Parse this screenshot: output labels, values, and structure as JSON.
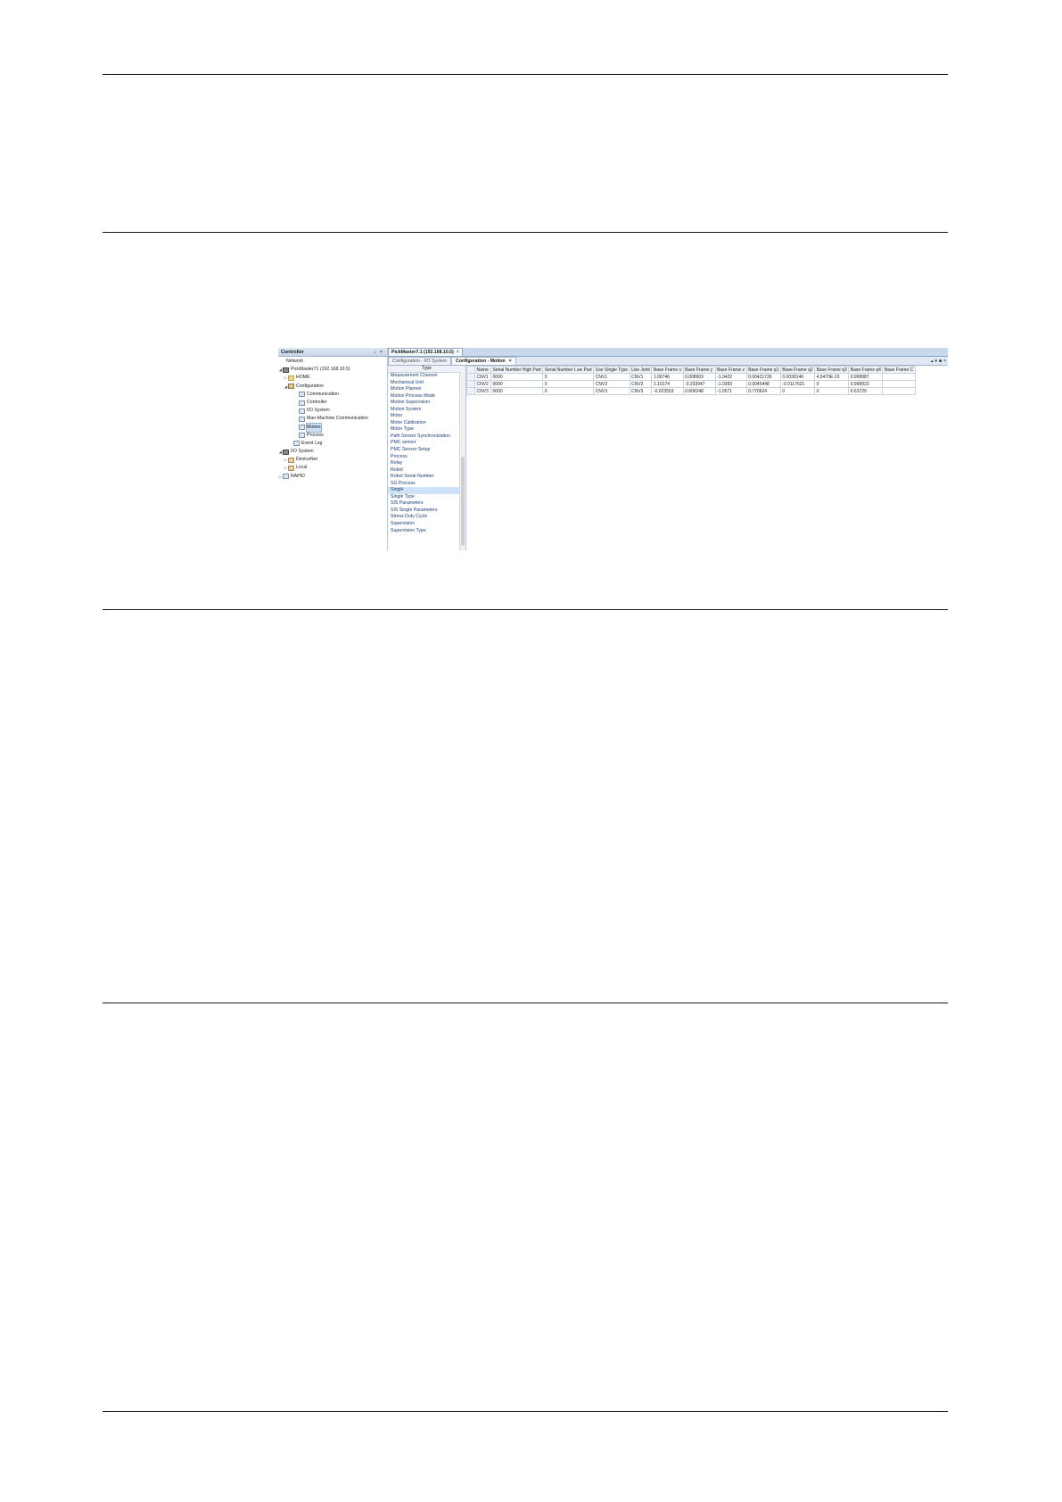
{
  "controller_pane": {
    "title": "Controller",
    "pin_glyph": "↓",
    "close_glyph": "×",
    "tree": [
      {
        "label": "Network",
        "icon": "none",
        "toggle": ""
      },
      {
        "label": "PickMaster71 (192.168.10.5)",
        "icon": "controller-icon",
        "toggle": "◢"
      },
      {
        "label": "HOME",
        "icon": "folder-icon",
        "toggle": "▷"
      },
      {
        "label": "Configuration",
        "icon": "configuration-icon",
        "toggle": "◢"
      },
      {
        "label": "Communication",
        "icon": "topic-icon",
        "toggle": ""
      },
      {
        "label": "Controller",
        "icon": "topic-icon",
        "toggle": ""
      },
      {
        "label": "I/O System",
        "icon": "topic-icon",
        "toggle": ""
      },
      {
        "label": "Man-Machine Communication",
        "icon": "topic-icon",
        "toggle": ""
      },
      {
        "label": "Motion",
        "icon": "topic-icon",
        "toggle": "",
        "selected": true
      },
      {
        "label": "Process",
        "icon": "topic-icon",
        "toggle": ""
      },
      {
        "label": "Event Log",
        "icon": "event-log-icon",
        "toggle": ""
      },
      {
        "label": "I/O System",
        "icon": "io-system-icon",
        "toggle": "◢"
      },
      {
        "label": "DeviceNet",
        "icon": "network-icon",
        "toggle": "▷"
      },
      {
        "label": "Local",
        "icon": "network-icon",
        "toggle": "▷"
      },
      {
        "label": "RAPID",
        "icon": "rapid-icon",
        "toggle": "▷"
      }
    ]
  },
  "document": {
    "tab_label": "PickMaster7.1 (192.168.10.5)",
    "tab_close": "×",
    "subtabs": [
      {
        "label": "Configuration - I/O System",
        "active": false
      },
      {
        "label": "Configuration - Motion",
        "active": true
      }
    ],
    "subtab_close": "×",
    "window_controls": [
      "▴",
      "▾",
      "■",
      "×"
    ]
  },
  "types_list": {
    "header": "Type",
    "items": [
      "Measurement Channel",
      "Mechanical Unit",
      "Motion Planner",
      "Motion Process Mode",
      "Motion Supervision",
      "Motion System",
      "Motor",
      "Motor Calibration",
      "Motor Type",
      "Path Sensor Synchronization",
      "PMC sensor",
      "PMC Sensor Setup",
      "Process",
      "Relay",
      "Robot",
      "Robot Serial Number",
      "SG Process",
      "Single",
      "Single Type",
      "SIS Parameters",
      "SIS Single Parameters",
      "Stress Duty Cycle",
      "Supervision",
      "Supervision Type"
    ],
    "selected": "Single"
  },
  "grid": {
    "columns": [
      "Name",
      "Serial Number High Part",
      "Serial Number Low Part",
      "Use Single Type",
      "Use Joint",
      "Base Frame x",
      "Base Frame y",
      "Base Frame z",
      "Base Frame q1",
      "Base Frame q2",
      "Base Frame q3",
      "Base Frame q4",
      "Base Frame C"
    ],
    "rows": [
      [
        "CNV1",
        "0000",
        "0",
        "CNV1",
        "CNV1",
        "1.06746",
        "0.008903",
        "-1.0422",
        "0.00421736",
        "0.0030146",
        "4.5470E-13",
        "0.999987",
        ""
      ],
      [
        "CNV2",
        "0000",
        "0",
        "CNV2",
        "CNV2",
        "1.10174",
        "-0.233947",
        "-1.0393",
        "0.0045448",
        "-0.0117621",
        "0",
        "0.999923",
        ""
      ],
      [
        "CNV3",
        "0000",
        "0",
        "CNV3",
        "CNV3",
        "-0.023553",
        "0.606248",
        "-1.0571",
        "0.770624",
        "0",
        "0",
        "0.63729",
        ""
      ]
    ]
  }
}
